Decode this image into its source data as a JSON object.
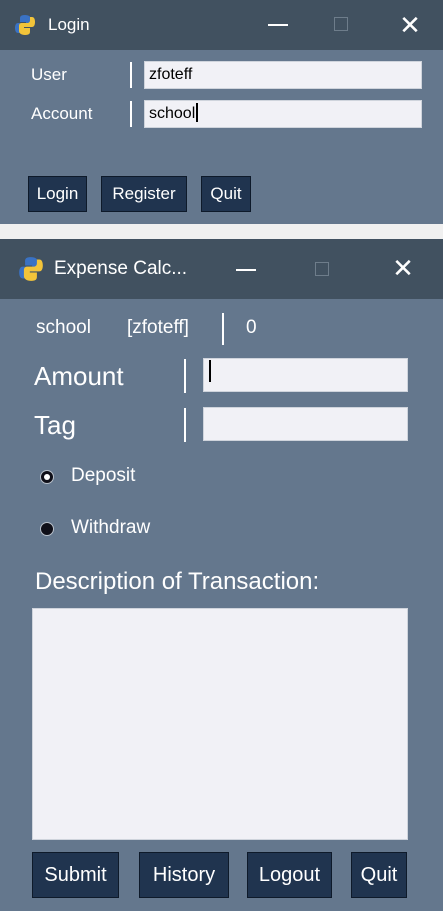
{
  "login_window": {
    "title": "Login",
    "user_label": "User",
    "user_value": "zfoteff",
    "account_label": "Account",
    "account_value": "school",
    "buttons": {
      "login": "Login",
      "register": "Register",
      "quit": "Quit"
    }
  },
  "expense_window": {
    "title": "Expense Calc...",
    "account_name": "school",
    "user_name": "[zfoteff]",
    "balance": "0",
    "amount_label": "Amount",
    "amount_value": "",
    "tag_label": "Tag",
    "tag_value": "",
    "radio": {
      "deposit_label": "Deposit",
      "withdraw_label": "Withdraw",
      "selected": "deposit"
    },
    "description_label": "Description of Transaction:",
    "description_value": "",
    "buttons": {
      "submit": "Submit",
      "history": "History",
      "logout": "Logout",
      "quit": "Quit"
    }
  },
  "icons": {
    "app": "python-icon",
    "minimize": "minimize-icon",
    "maximize": "maximize-icon",
    "close": "close-icon"
  },
  "colors": {
    "window_bg": "#64778d",
    "titlebar_bg": "#415160",
    "button_bg": "#20344f",
    "entry_bg": "#f1f1f6"
  }
}
